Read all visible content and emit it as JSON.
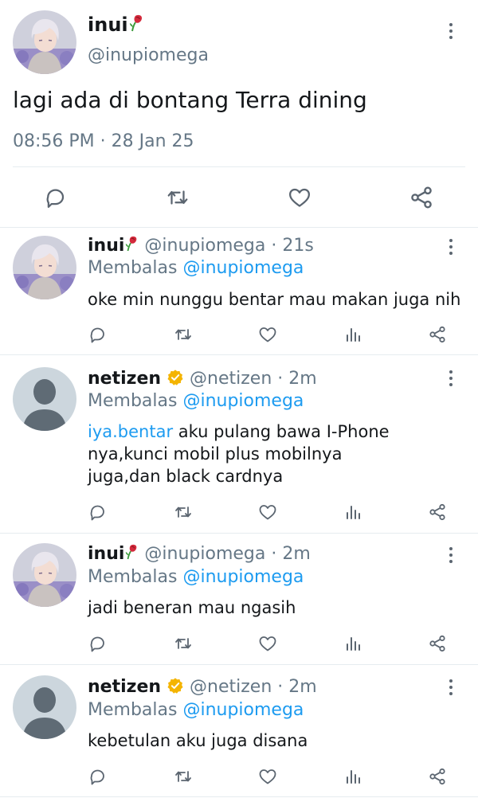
{
  "colors": {
    "link": "#1d9bf0",
    "muted": "#657786",
    "verified": "#f4b400",
    "divider": "#e6ecf0"
  },
  "main_tweet": {
    "display_name": "inui",
    "handle": "@inupiomega",
    "text": "lagi ada di bontang Terra dining",
    "timestamp": "08:56 PM · 28 Jan 25"
  },
  "replies": [
    {
      "display_name": "inui",
      "handle": "@inupiomega",
      "time": "· 21s",
      "replying_label": "Membalas",
      "replying_to": "@inupiomega",
      "mention": "",
      "text": "oke min nunggu bentar mau makan juga nih",
      "verified": false
    },
    {
      "display_name": "netizen",
      "handle": "@netizen",
      "time": "· 2m",
      "replying_label": "Membalas",
      "replying_to": "@inupiomega",
      "mention": "iya.bentar",
      "text": " aku pulang bawa I-Phone nya,kunci mobil plus mobilnya juga,dan black cardnya",
      "verified": true
    },
    {
      "display_name": "inui",
      "handle": "@inupiomega",
      "time": "· 2m",
      "replying_label": "Membalas",
      "replying_to": "@inupiomega",
      "mention": "",
      "text": "jadi beneran mau ngasih",
      "verified": false
    },
    {
      "display_name": "netizen",
      "handle": "@netizen",
      "time": "· 2m",
      "replying_label": "Membalas",
      "replying_to": "@inupiomega",
      "mention": "",
      "text": "kebetulan aku juga disana",
      "verified": true
    }
  ],
  "icons": [
    "reply-icon",
    "retweet-icon",
    "like-icon",
    "analytics-icon",
    "share-icon",
    "more-icon",
    "rose-emoji-icon",
    "verified-badge-icon"
  ]
}
